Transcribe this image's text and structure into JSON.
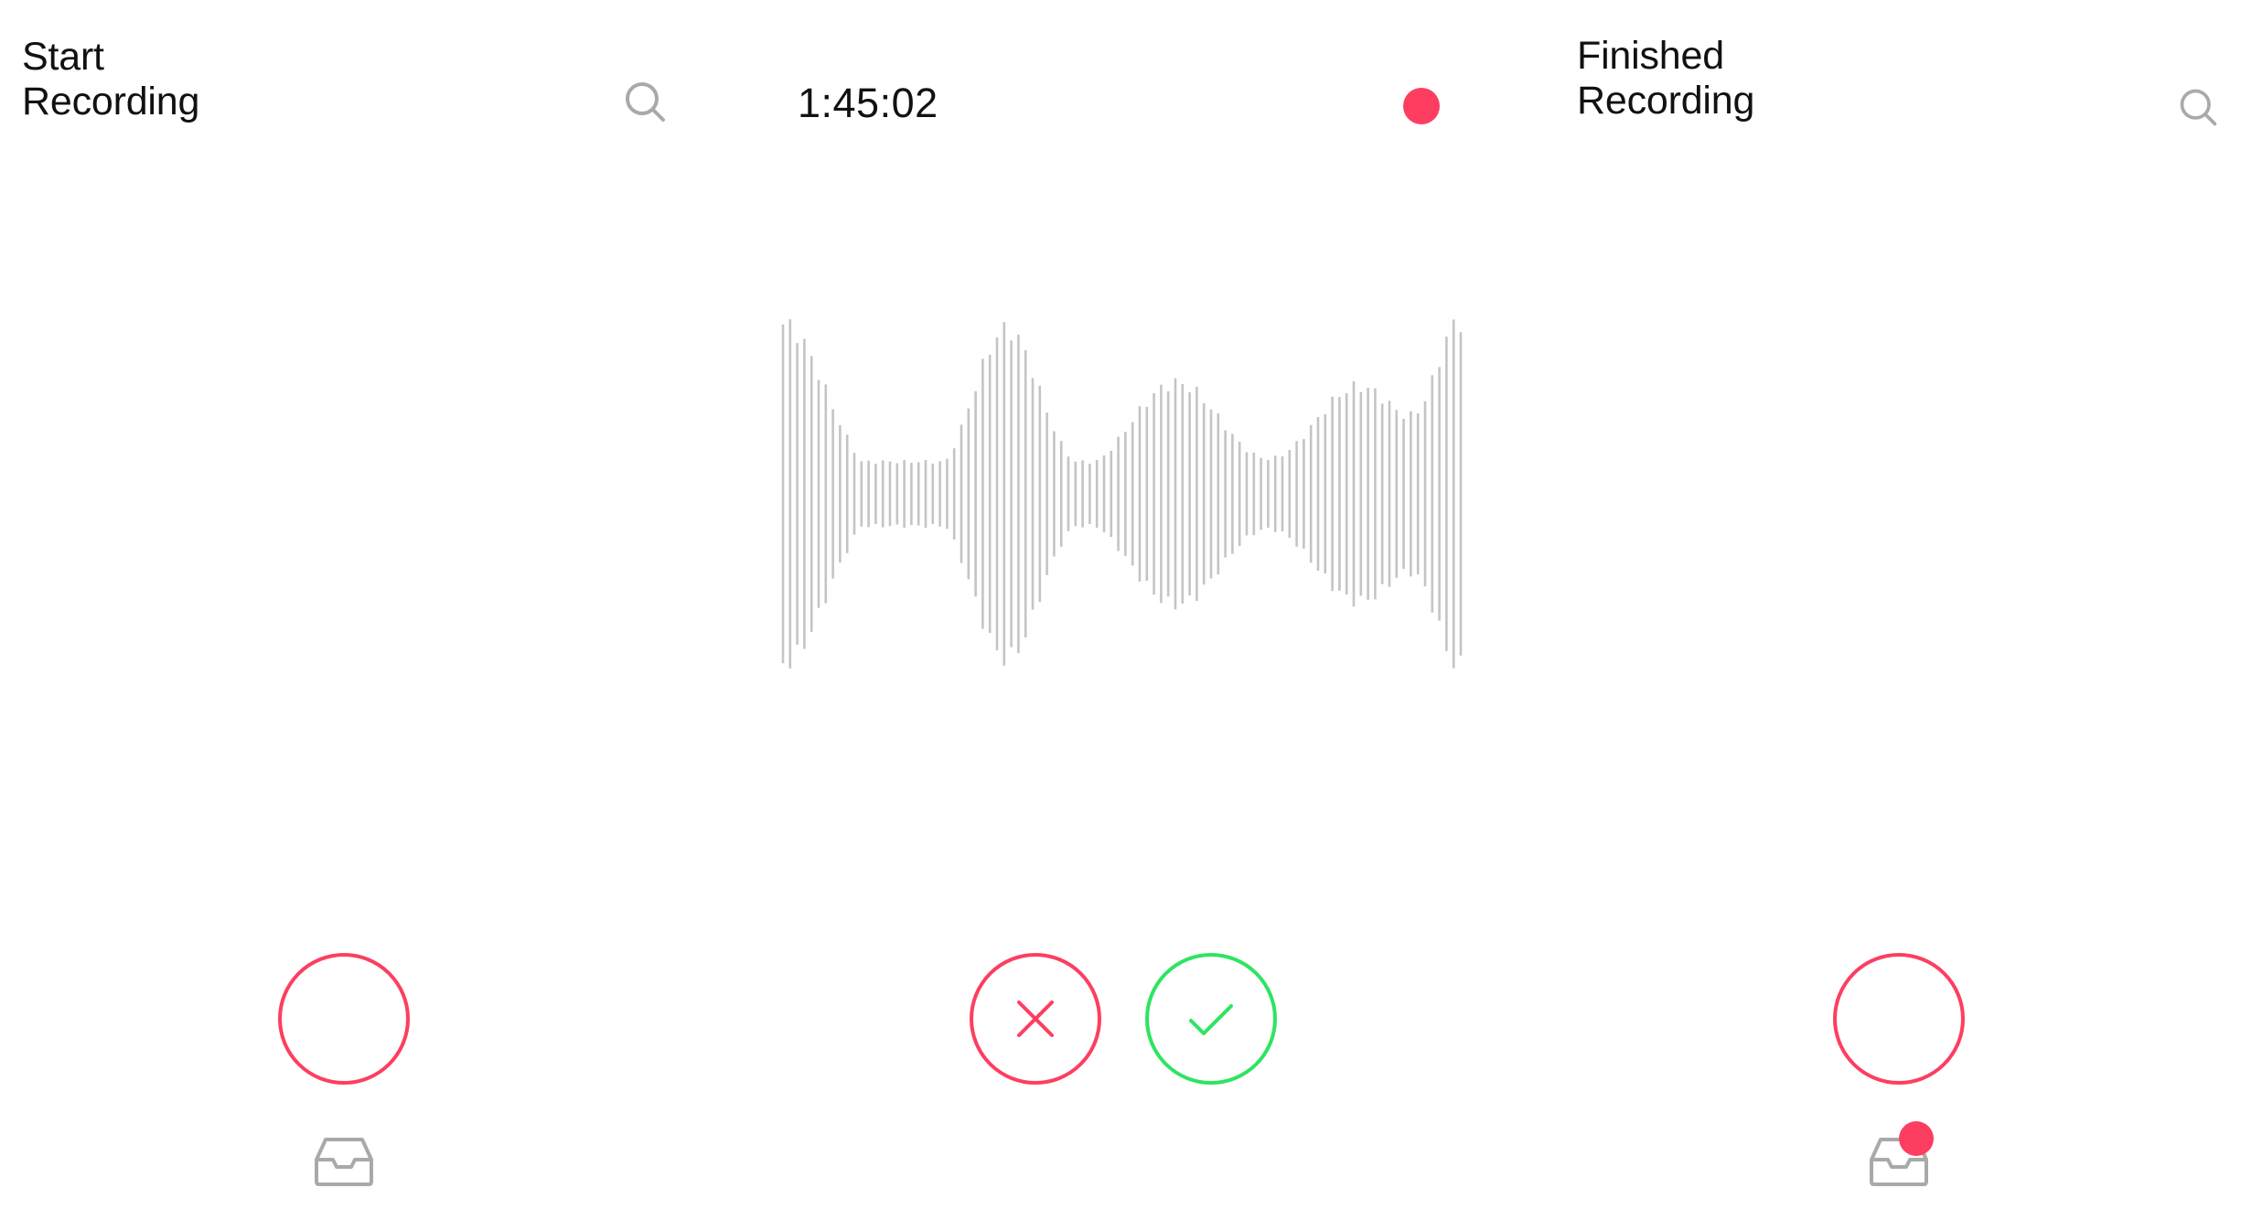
{
  "colors": {
    "accent_red": "#fd3e60",
    "accent_green": "#2ee462",
    "icon_gray": "#a9a9a9",
    "wave_gray": "#c4c4c4",
    "text": "#111111",
    "background": "#ffffff"
  },
  "screens": {
    "start": {
      "title_line1": "Start",
      "title_line2": "Recording",
      "search_icon": "search-icon",
      "record_button_icon": "record-button",
      "inbox_icon": "inbox-icon"
    },
    "recording": {
      "timer": "1:45:02",
      "recording_indicator": "recording-dot",
      "cancel_icon": "close-icon",
      "confirm_icon": "check-icon"
    },
    "finished": {
      "title_line1": "Finished",
      "title_line2": "Recording",
      "search_icon": "search-icon",
      "record_button_icon": "record-button",
      "inbox_icon": "inbox-icon",
      "inbox_has_notification": true
    }
  }
}
